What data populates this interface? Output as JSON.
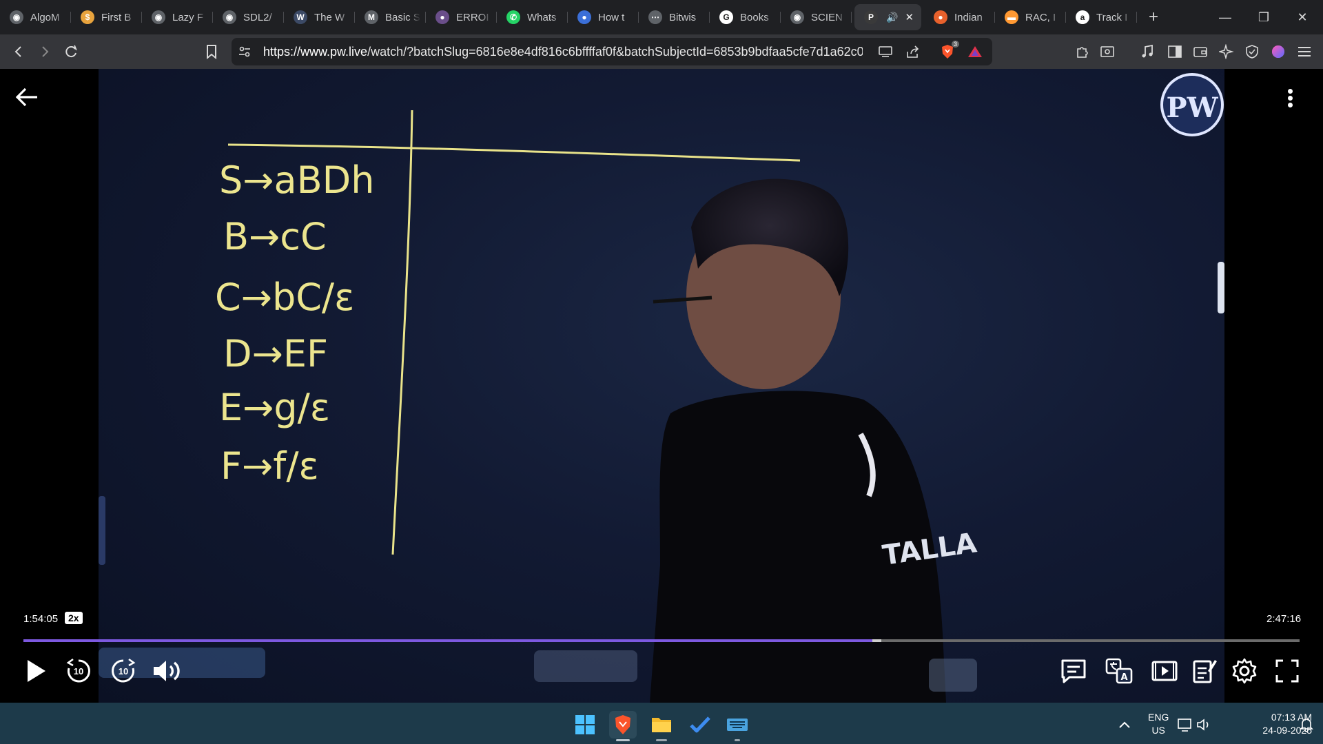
{
  "browser": {
    "tabs": [
      {
        "title": "AlgoM",
        "icon": "globe-icon",
        "color": "#5f6368"
      },
      {
        "title": "First B",
        "icon": "dollar-icon",
        "color": "#e8a33d"
      },
      {
        "title": "Lazy F",
        "icon": "globe-icon",
        "color": "#5f6368"
      },
      {
        "title": "SDL2/",
        "icon": "globe-icon",
        "color": "#5f6368"
      },
      {
        "title": "The W",
        "icon": "wordpress-icon",
        "color": "#3c4a66"
      },
      {
        "title": "Basic S",
        "icon": "markdown-icon",
        "color": "#5f6368"
      },
      {
        "title": "ERROI",
        "icon": "error-icon",
        "color": "#6a4e8a"
      },
      {
        "title": "Whats",
        "icon": "whatsapp-icon",
        "color": "#25d366"
      },
      {
        "title": "How t",
        "icon": "circle-icon",
        "color": "#3b6fd8"
      },
      {
        "title": "Bitwis",
        "icon": "bitwise-icon",
        "color": "#5f6368"
      },
      {
        "title": "Books",
        "icon": "google-icon",
        "color": "#ffffff"
      },
      {
        "title": "SCIEN",
        "icon": "globe-icon",
        "color": "#5f6368"
      },
      {
        "title": "",
        "icon": "pw-icon",
        "color": "#3a3a3a",
        "active": true,
        "audio": "🔊",
        "close": "✕"
      },
      {
        "title": "Indian",
        "icon": "food-icon",
        "color": "#e8612c"
      },
      {
        "title": "RAC, I",
        "icon": "flag-icon",
        "color": "#ff9933"
      },
      {
        "title": "Track I",
        "icon": "amazon-icon",
        "color": "#ffffff"
      }
    ],
    "new_tab": "+",
    "window_controls": {
      "minimize": "—",
      "restore": "❐",
      "close": "✕"
    },
    "url_host": "https://www.pw.live",
    "url_path": "/watch/?batchSlug=6816e8e4df816c6bffffaf0f&batchSubjectId=6853b9bdfaa5cfe7d1a62c0...",
    "brave_badge": "3"
  },
  "player": {
    "board_lines": [
      "S→aBDh",
      "B→cC",
      "C→bC/ε",
      "D→EF",
      "E→g/ε",
      "F→f/ε"
    ],
    "watermark": "PW",
    "shirt_text": "TALLA",
    "elapsed": "1:54:05",
    "speed": "2x",
    "duration": "2:47:16",
    "progress_fraction": 0.665,
    "buffer_fraction": 0.672,
    "rewind_seconds": "10",
    "forward_seconds": "10"
  },
  "taskbar": {
    "lang_line1": "ENG",
    "lang_line2": "US",
    "time": "07:13 AM",
    "date": "24-09-2025"
  }
}
